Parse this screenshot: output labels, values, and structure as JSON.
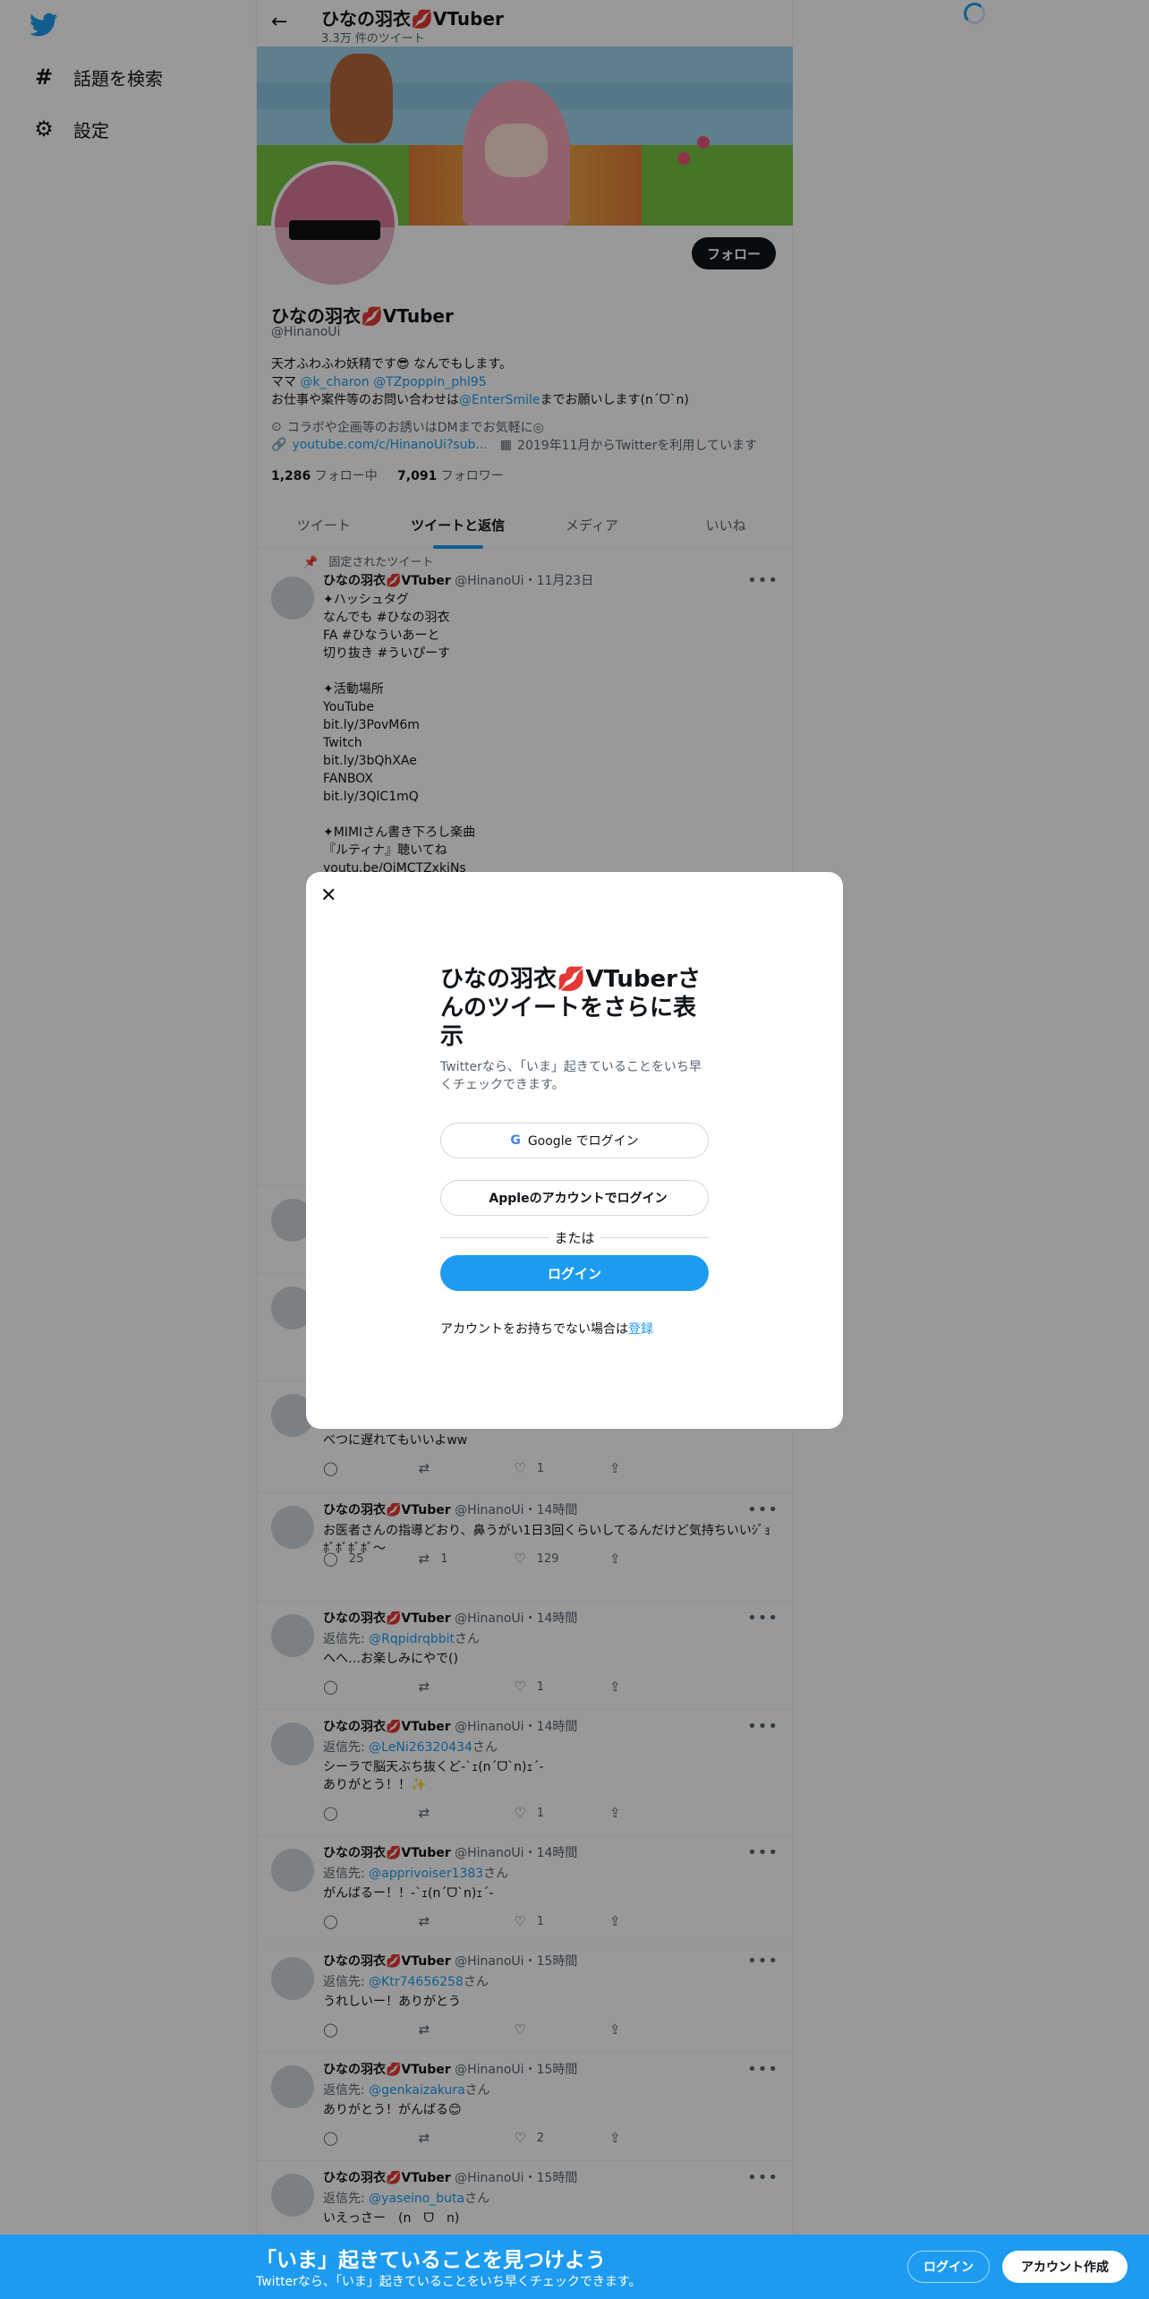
{
  "nav": {
    "explore_label": "話題を検索",
    "settings_label": "設定"
  },
  "header": {
    "name": "ひなの羽衣💋VTuber",
    "tweet_count": "3.3万 件のツイート"
  },
  "profile": {
    "follow_label": "フォロー",
    "name": "ひなの羽衣💋VTuber",
    "handle": "@HinanoUi",
    "bio_line1": "天才ふわふわ妖精です😎 なんでもします。",
    "bio_line2_prefix": "ママ ",
    "bio_mama1": "@k_charon",
    "bio_mama2": "@TZpoppin_phl95",
    "bio_line3_prefix": "お仕事や案件等のお問い合わせは",
    "bio_line3_link": "@EnterSmile",
    "bio_line3_suffix": "までお願いします(ո´ᗜ`ո)",
    "location": "コラボや企画等のお誘いはDMまでお気軽に◎",
    "url": "youtube.com/c/HinanoUi?sub...",
    "joined": "2019年11月からTwitterを利用しています",
    "following_count": "1,286",
    "following_label": "フォロー中",
    "followers_count": "7,091",
    "followers_label": "フォロワー"
  },
  "tabs": [
    "ツイート",
    "ツイートと返信",
    "メディア",
    "いいね"
  ],
  "pinned_label": "固定されたツイート",
  "pinned_tweet": {
    "name": "ひなの羽衣💋VTuber",
    "meta": "@HinanoUi・11月23日",
    "body": "✦ハッシュタグ\nなんでも #ひなの羽衣\nFA #ひなういあーと\n切り抜き #ういぴーす\n\n✦活動場所\nYouTube\nbit.ly/3PovM6m\nTwitch\nbit.ly/3bQhXAe\nFANBOX\nbit.ly/3QlC1mQ\n\n✦MIMIさん書き下ろし楽曲\n『ルティナ』聴いてね\nyoutu.be/OjMCTZxkiNs"
  },
  "partial_tweet_body": "べつに遅れてもいいよww",
  "partial_tweet_likes": "1",
  "tweets": [
    {
      "name": "ひなの羽衣💋VTuber",
      "meta": "@HinanoUi・14時間",
      "reply": "",
      "body": "お医者さんの指導どおり、鼻うがい1日3回くらいしてるんだけど気持ちいいｼﾞｮﾎﾞﾎﾞﾎﾞﾎﾞ〜",
      "replies": "25",
      "retweets": "1",
      "likes": "129"
    },
    {
      "name": "ひなの羽衣💋VTuber",
      "meta": "@HinanoUi・14時間",
      "reply": "@Rqpidrqbbit",
      "body": "へへ…お楽しみにやで()",
      "replies": "",
      "retweets": "",
      "likes": "1"
    },
    {
      "name": "ひなの羽衣💋VTuber",
      "meta": "@HinanoUi・14時間",
      "reply": "@LeNi26320434",
      "body": "シーラで脳天ぶち抜くど-`ｪ(ո´ᗜ`ո)ｪ´-\nありがとう！！✨",
      "replies": "",
      "retweets": "",
      "likes": "1"
    },
    {
      "name": "ひなの羽衣💋VTuber",
      "meta": "@HinanoUi・14時間",
      "reply": "@apprivoiser1383",
      "body": "がんばるー！！-`ｪ(ո´ᗜ`ո)ｪ´-",
      "replies": "",
      "retweets": "",
      "likes": "1"
    },
    {
      "name": "ひなの羽衣💋VTuber",
      "meta": "@HinanoUi・15時間",
      "reply": "@Ktr74656258",
      "body": "うれしいー！ありがとう",
      "replies": "",
      "retweets": "",
      "likes": ""
    },
    {
      "name": "ひなの羽衣💋VTuber",
      "meta": "@HinanoUi・15時間",
      "reply": "@genkaizakura",
      "body": "ありがとう！がんばる😊",
      "replies": "",
      "retweets": "",
      "likes": "2"
    },
    {
      "name": "ひなの羽衣💋VTuber",
      "meta": "@HinanoUi・15時間",
      "reply": "@yaseino_buta",
      "body": "いえっさー　(ո　ᗜ　ո)",
      "replies": "",
      "retweets": "",
      "likes": ""
    }
  ],
  "reply_prefix": "返信先: ",
  "reply_suffix": "さん",
  "modal": {
    "title": "ひなの羽衣💋VTuberさんのツイートをさらに表示",
    "subtitle": "Twitterなら、「いま」起きていることをいち早くチェックできます。",
    "google_label": "Google でログイン",
    "apple_label": "Appleのアカウントでログイン",
    "or_label": "または",
    "login_label": "ログイン",
    "signup_prefix": "アカウントをお持ちでない場合は",
    "signup_link": "登録"
  },
  "bottom_bar": {
    "title": "「いま」起きていることを見つけよう",
    "subtitle": "Twitterなら、「いま」起きていることをいち早くチェックできます。",
    "login_label": "ログイン",
    "signup_label": "アカウント作成"
  },
  "colors": {
    "accent": "#1d9bf0",
    "text": "#0f1419",
    "muted": "#536471"
  }
}
